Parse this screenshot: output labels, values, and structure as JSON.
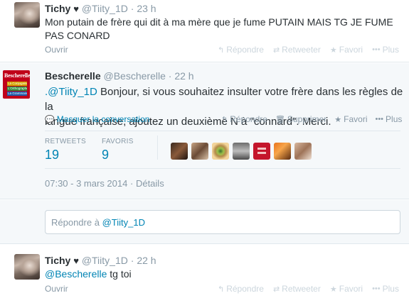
{
  "tweets": [
    {
      "fullname": "Tichy",
      "heart": "♥",
      "username": "@Tiity_1D",
      "sep": "·",
      "time": "23 h",
      "text_line1": "Mon putain de frère qui dit à ma mère que je fume PUTAIN MAIS TG JE FUME",
      "text_line2": "PAS CONARD",
      "expand": "Ouvrir",
      "actions": {
        "reply": "Répondre",
        "retweet": "Retweeter",
        "favorite": "Favori",
        "more": "Plus"
      }
    },
    {
      "fullname": "Bescherelle",
      "username": "@Bescherelle",
      "sep": "·",
      "time": "22 h",
      "mention": ".@Tiity_1D",
      "text_line1": " Bonjour, si vous souhaitez insulter votre frère dans les règles de la",
      "text_line2": "langue française, ajoutez un deuxième N à \"connard\". Merci.",
      "expand": "Masquer la conversation",
      "actions": {
        "reply": "Répondre",
        "delete": "Supprimer",
        "favorite": "Favori",
        "more": "Plus"
      },
      "retweets_label": "RETWEETS",
      "retweets": "19",
      "favorites_label": "FAVORIS",
      "favorites": "9",
      "timestamp": "07:30 - 3 mars 2014",
      "details_sep": "·",
      "details": "Détails",
      "avatar": {
        "title": "Bescherelle",
        "lines": [
          "La Conjugaison",
          "L'Orthographe",
          "La Grammaire"
        ]
      }
    },
    {
      "fullname": "Tichy",
      "heart": "♥",
      "username": "@Tiity_1D",
      "sep": "·",
      "time": "22 h",
      "mention": "@Bescherelle",
      "text_rest": " tg toi",
      "expand": "Ouvrir",
      "actions": {
        "reply": "Répondre",
        "retweet": "Retweeter",
        "favorite": "Favori",
        "more": "Plus"
      }
    }
  ],
  "reply": {
    "prefix": "Répondre à ",
    "mention": "@Tiity_1D"
  },
  "colors": {
    "link": "#0084b4",
    "muted": "#8899a6",
    "text": "#292f33",
    "bescherelle_red": "#c0001a"
  },
  "icons": {
    "reply": "reply-arrow-icon",
    "retweet": "retweet-icon",
    "favorite": "star-icon",
    "more": "ellipsis-icon",
    "delete": "trash-icon",
    "conversation": "speech-bubble-icon"
  }
}
